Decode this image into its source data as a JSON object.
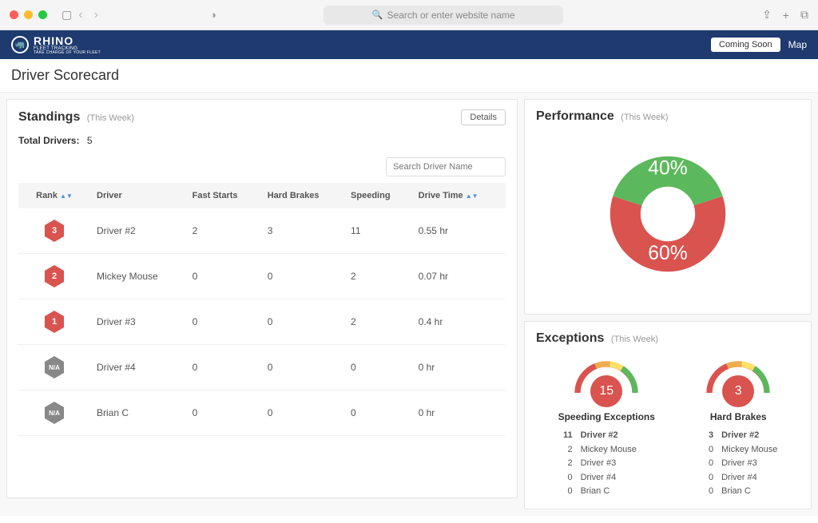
{
  "browser": {
    "url_placeholder": "Search or enter website name"
  },
  "app": {
    "brand_main": "RHINO",
    "brand_sub": "FLEET TRACKING",
    "brand_tag": "TAKE CHARGE OF YOUR FLEET",
    "coming_soon": "Coming Soon",
    "map": "Map"
  },
  "page": {
    "title": "Driver Scorecard"
  },
  "standings": {
    "title": "Standings",
    "period": "(This Week)",
    "details_btn": "Details",
    "total_label": "Total Drivers:",
    "total_value": "5",
    "search_placeholder": "Search Driver Name",
    "columns": {
      "rank": "Rank",
      "driver": "Driver",
      "fast_starts": "Fast Starts",
      "hard_brakes": "Hard Brakes",
      "speeding": "Speeding",
      "drive_time": "Drive Time"
    },
    "rows": [
      {
        "rank": "3",
        "rank_type": "hex",
        "driver": "Driver #2",
        "fast_starts": "2",
        "hard_brakes": "3",
        "speeding": "11",
        "drive_time": "0.55 hr"
      },
      {
        "rank": "2",
        "rank_type": "hex",
        "driver": "Mickey Mouse",
        "fast_starts": "0",
        "hard_brakes": "0",
        "speeding": "2",
        "drive_time": "0.07 hr"
      },
      {
        "rank": "1",
        "rank_type": "hex",
        "driver": "Driver #3",
        "fast_starts": "0",
        "hard_brakes": "0",
        "speeding": "2",
        "drive_time": "0.4 hr"
      },
      {
        "rank": "N/A",
        "rank_type": "na",
        "driver": "Driver #4",
        "fast_starts": "0",
        "hard_brakes": "0",
        "speeding": "0",
        "drive_time": "0 hr"
      },
      {
        "rank": "N/A",
        "rank_type": "na",
        "driver": "Brian C",
        "fast_starts": "0",
        "hard_brakes": "0",
        "speeding": "0",
        "drive_time": "0 hr"
      }
    ]
  },
  "performance": {
    "title": "Performance",
    "period": "(This Week)"
  },
  "chart_data": {
    "type": "pie",
    "title": "Performance (This Week)",
    "series": [
      {
        "name": "Green",
        "value": 40,
        "label": "40%",
        "color": "#5cb85c"
      },
      {
        "name": "Red",
        "value": 60,
        "label": "60%",
        "color": "#d9534f"
      }
    ]
  },
  "exceptions": {
    "title": "Exceptions",
    "period": "(This Week)",
    "groups": [
      {
        "total": "15",
        "label": "Speeding Exceptions",
        "items": [
          {
            "count": "11",
            "driver": "Driver #2"
          },
          {
            "count": "2",
            "driver": "Mickey Mouse"
          },
          {
            "count": "2",
            "driver": "Driver #3"
          },
          {
            "count": "0",
            "driver": "Driver #4"
          },
          {
            "count": "0",
            "driver": "Brian C"
          }
        ]
      },
      {
        "total": "3",
        "label": "Hard Brakes",
        "items": [
          {
            "count": "3",
            "driver": "Driver #2"
          },
          {
            "count": "0",
            "driver": "Mickey Mouse"
          },
          {
            "count": "0",
            "driver": "Driver #3"
          },
          {
            "count": "0",
            "driver": "Driver #4"
          },
          {
            "count": "0",
            "driver": "Brian C"
          }
        ]
      }
    ]
  }
}
